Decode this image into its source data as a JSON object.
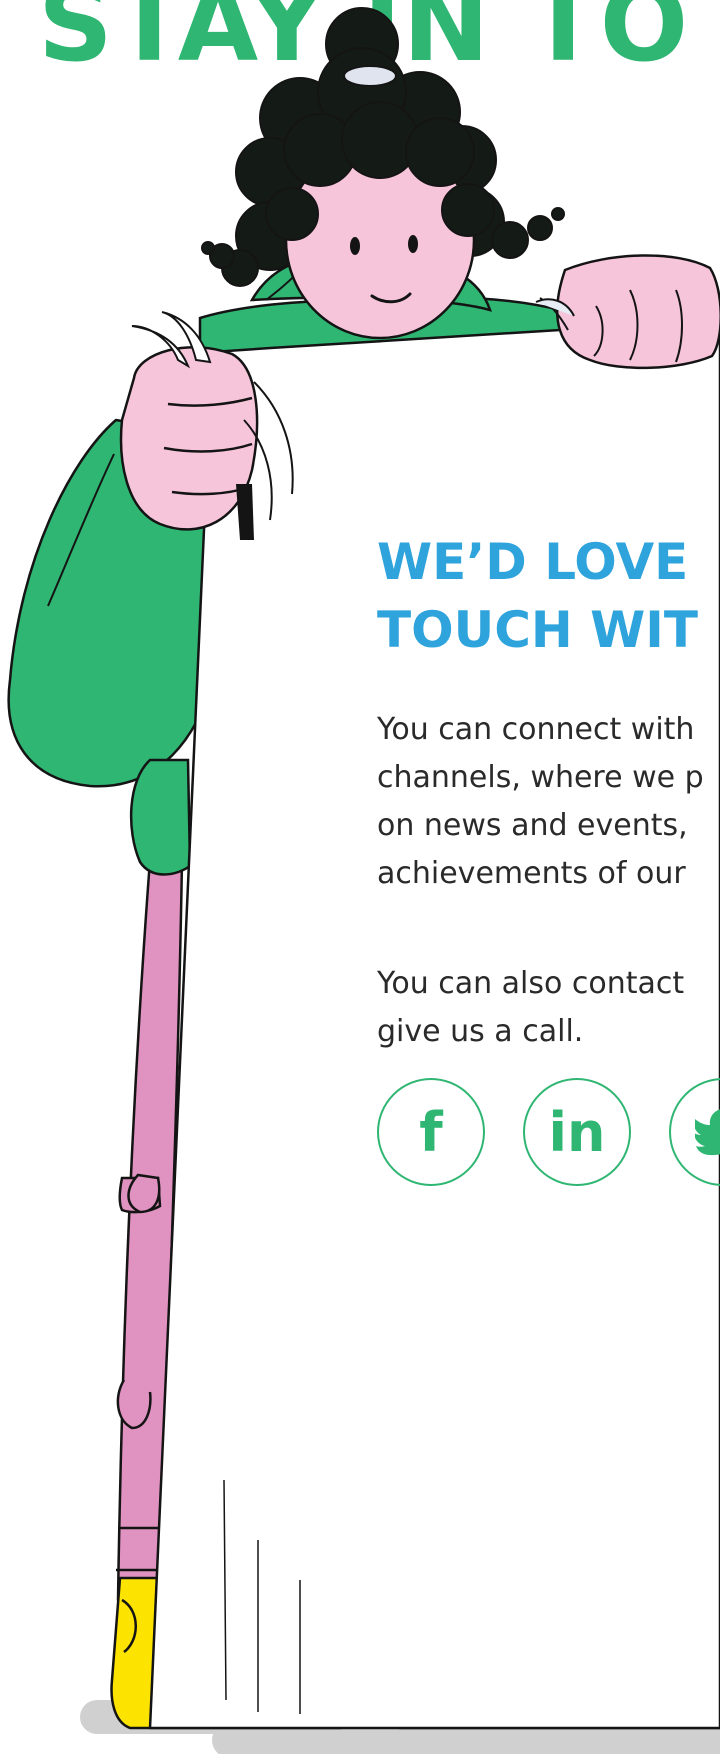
{
  "banner": {
    "title": "STAY IN TO"
  },
  "contact": {
    "heading_lines": [
      "WE’D LOVE",
      "TOUCH WIT"
    ],
    "paragraph_1_lines": [
      "You can connect with",
      "channels, where we p",
      "on news and events,",
      "achievements of our"
    ],
    "paragraph_2_lines": [
      "You can also contact",
      "give us a call."
    ]
  },
  "socials": [
    {
      "name": "facebook",
      "glyph": "f",
      "icon": "facebook-icon"
    },
    {
      "name": "linkedin",
      "glyph": "in",
      "icon": "linkedin-icon"
    },
    {
      "name": "twitter",
      "glyph": "",
      "icon": "twitter-icon"
    }
  ],
  "colors": {
    "green": "#2fb673",
    "blue": "#2ea3dc",
    "text": "#2a2a2a",
    "hair": "#141a16",
    "skin": "#f7c5da",
    "pants": "#e093c1",
    "shoes": "#fde300",
    "shadow": "#d0d0d0"
  }
}
